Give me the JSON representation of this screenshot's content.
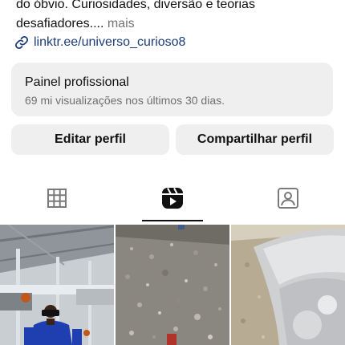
{
  "profile": {
    "bio_line1": "do óbvio. Curiosidades, diversão e teorias",
    "bio_line2": "desafiadores....",
    "more_label": " mais",
    "link": "linktr.ee/universo_curioso8"
  },
  "professional_panel": {
    "title": "Painel profissional",
    "subtitle": "69 mi visualizações nos últimos 30 dias."
  },
  "actions": {
    "edit_label": "Editar perfil",
    "share_label": "Compartilhar perfil"
  },
  "tabs": [
    {
      "icon": "grid-icon",
      "selected": false
    },
    {
      "icon": "reels-icon",
      "selected": true
    },
    {
      "icon": "tagged-icon",
      "selected": false
    }
  ],
  "colors": {
    "link": "#1d3d7a",
    "card": "#efefef",
    "muted": "#737373"
  },
  "thumbnails": [
    {
      "subject": "gym-scene"
    },
    {
      "subject": "gravel-ground"
    },
    {
      "subject": "cushion-closeup"
    }
  ]
}
